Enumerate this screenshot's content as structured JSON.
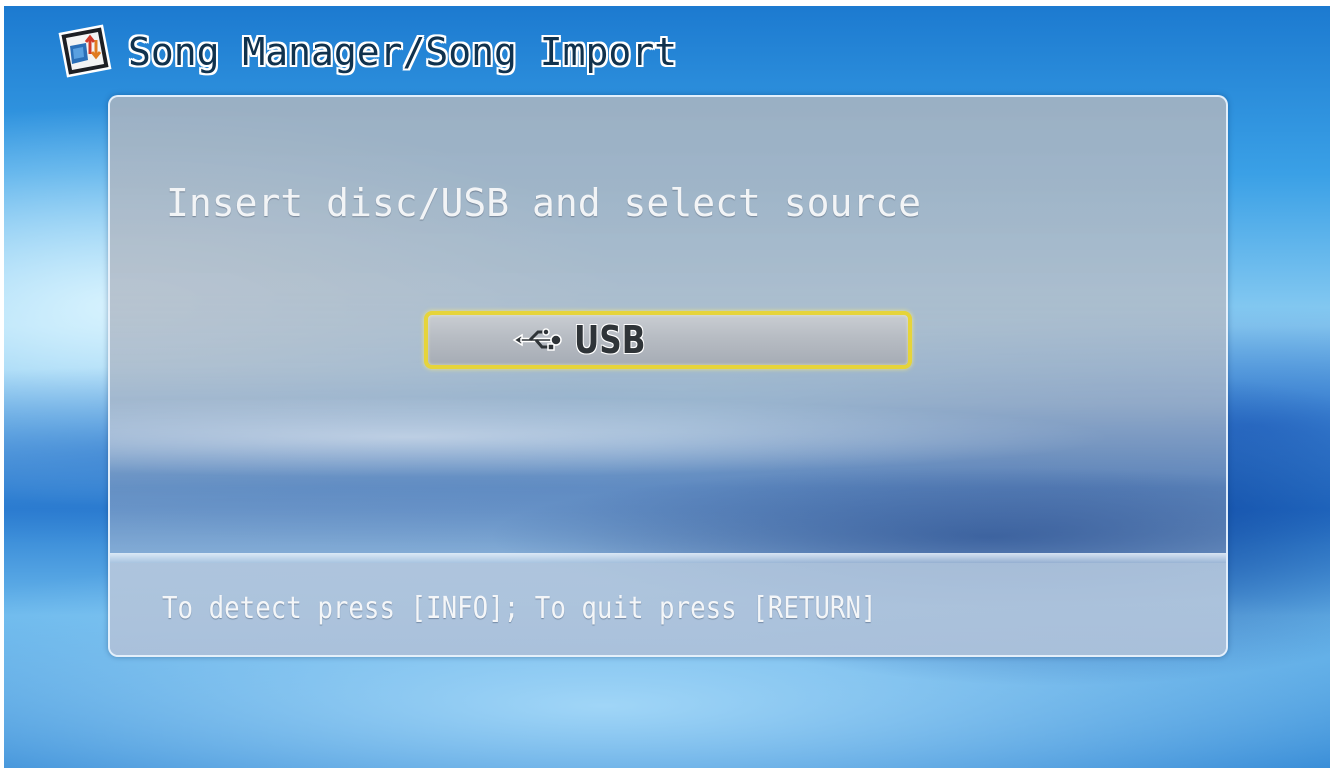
{
  "header": {
    "title": "Song Manager/Song Import",
    "icon": "song-manager-icon"
  },
  "dialog": {
    "prompt": "Insert disc/USB and select source",
    "sources": [
      {
        "label": "USB",
        "icon": "usb-icon",
        "selected": true
      }
    ],
    "hint": "To detect press [INFO]; To quit press [RETURN]"
  },
  "colors": {
    "selection_border": "#e6d43a",
    "title_text": "#10324e",
    "prompt_text": "#f2f4f6"
  }
}
